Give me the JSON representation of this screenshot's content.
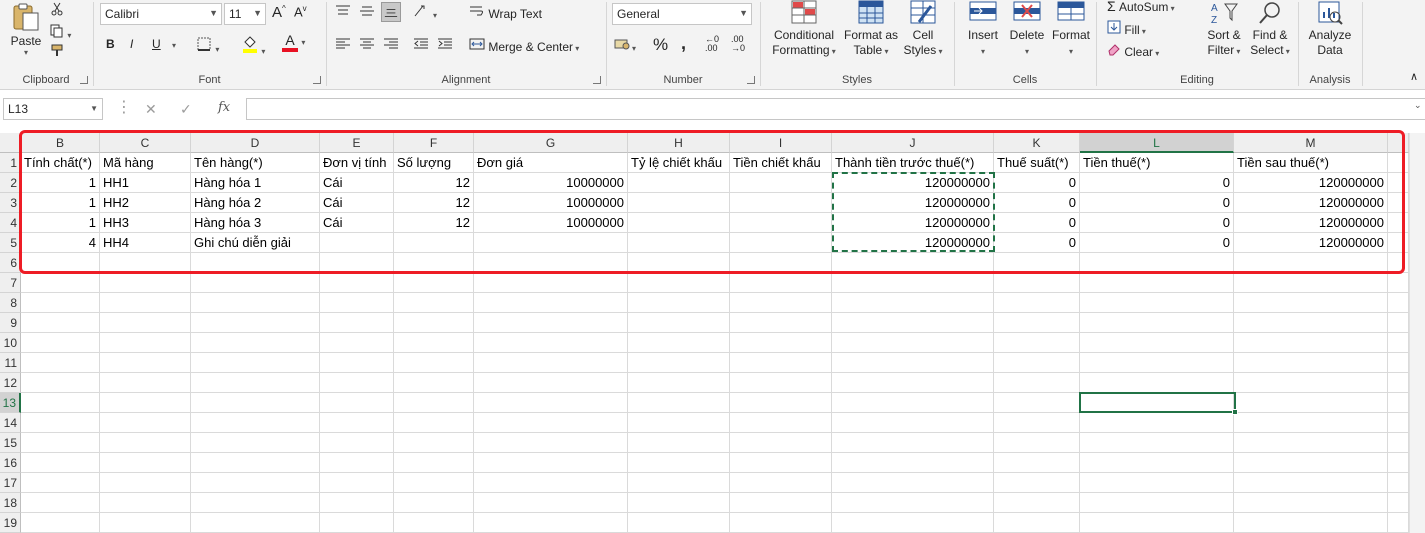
{
  "ribbon": {
    "clipboard": {
      "paste": "Paste",
      "label": "Clipboard"
    },
    "font": {
      "name": "Calibri",
      "size": "11",
      "bold": "B",
      "italic": "I",
      "underline": "U",
      "font_color_glyph": "A",
      "label": "Font"
    },
    "alignment": {
      "wrap_text": "Wrap Text",
      "merge_center": "Merge & Center",
      "label": "Alignment"
    },
    "number": {
      "format": "General",
      "percent": "%",
      "comma": ",",
      "inc_decimal": ".00",
      "dec_decimal": ".00",
      "label": "Number"
    },
    "styles": {
      "conditional_1": "Conditional",
      "conditional_2": "Formatting",
      "format_table_1": "Format as",
      "format_table_2": "Table",
      "cell_styles_1": "Cell",
      "cell_styles_2": "Styles",
      "label": "Styles"
    },
    "cells": {
      "insert": "Insert",
      "delete": "Delete",
      "format": "Format",
      "label": "Cells"
    },
    "editing": {
      "autosum": "AutoSum",
      "fill": "Fill",
      "clear": "Clear",
      "sort_1": "Sort &",
      "sort_2": "Filter",
      "find_1": "Find &",
      "find_2": "Select",
      "label": "Editing"
    },
    "analysis": {
      "analyze_1": "Analyze",
      "analyze_2": "Data",
      "label": "Analysis"
    }
  },
  "formula_bar": {
    "name_box": "L13",
    "fx": "fx",
    "formula": ""
  },
  "sheet": {
    "columns": [
      "B",
      "C",
      "D",
      "E",
      "F",
      "G",
      "H",
      "I",
      "J",
      "K",
      "L",
      "M"
    ],
    "rows": [
      "1",
      "2",
      "3",
      "4",
      "5",
      "6",
      "7",
      "8",
      "9",
      "10",
      "11",
      "12",
      "13",
      "14",
      "15",
      "16",
      "17",
      "18",
      "19"
    ],
    "active_cell": "L13",
    "header_row": [
      "Tính chất(*)",
      "Mã hàng",
      "Tên hàng(*)",
      "Đơn vị tính",
      "Số lượng",
      "Đơn giá",
      "Tỷ lệ chiết khấu",
      "Tiền chiết khấu",
      "Thành tiền trước thuế(*)",
      "Thuế suất(*)",
      "Tiền thuế(*)",
      "Tiền sau thuế(*)"
    ],
    "data_rows": [
      [
        "1",
        "HH1",
        "Hàng hóa 1",
        "Cái",
        "12",
        "10000000",
        "",
        "",
        "120000000",
        "0",
        "0",
        "120000000"
      ],
      [
        "1",
        "HH2",
        "Hàng hóa 2",
        "Cái",
        "12",
        "10000000",
        "",
        "",
        "120000000",
        "0",
        "0",
        "120000000"
      ],
      [
        "1",
        "HH3",
        "Hàng hóa 3",
        "Cái",
        "12",
        "10000000",
        "",
        "",
        "120000000",
        "0",
        "0",
        "120000000"
      ],
      [
        "4",
        "HH4",
        "Ghi chú diễn giải",
        "",
        "",
        "",
        "",
        "",
        "120000000",
        "0",
        "0",
        "120000000"
      ]
    ],
    "numeric_columns": [
      0,
      4,
      5,
      8,
      9,
      10,
      11
    ]
  },
  "colors": {
    "excel_green": "#217346",
    "highlight_red": "#ee1c25",
    "font_color_bar": "#e81123",
    "fill_color_bar": "#ffff00"
  }
}
